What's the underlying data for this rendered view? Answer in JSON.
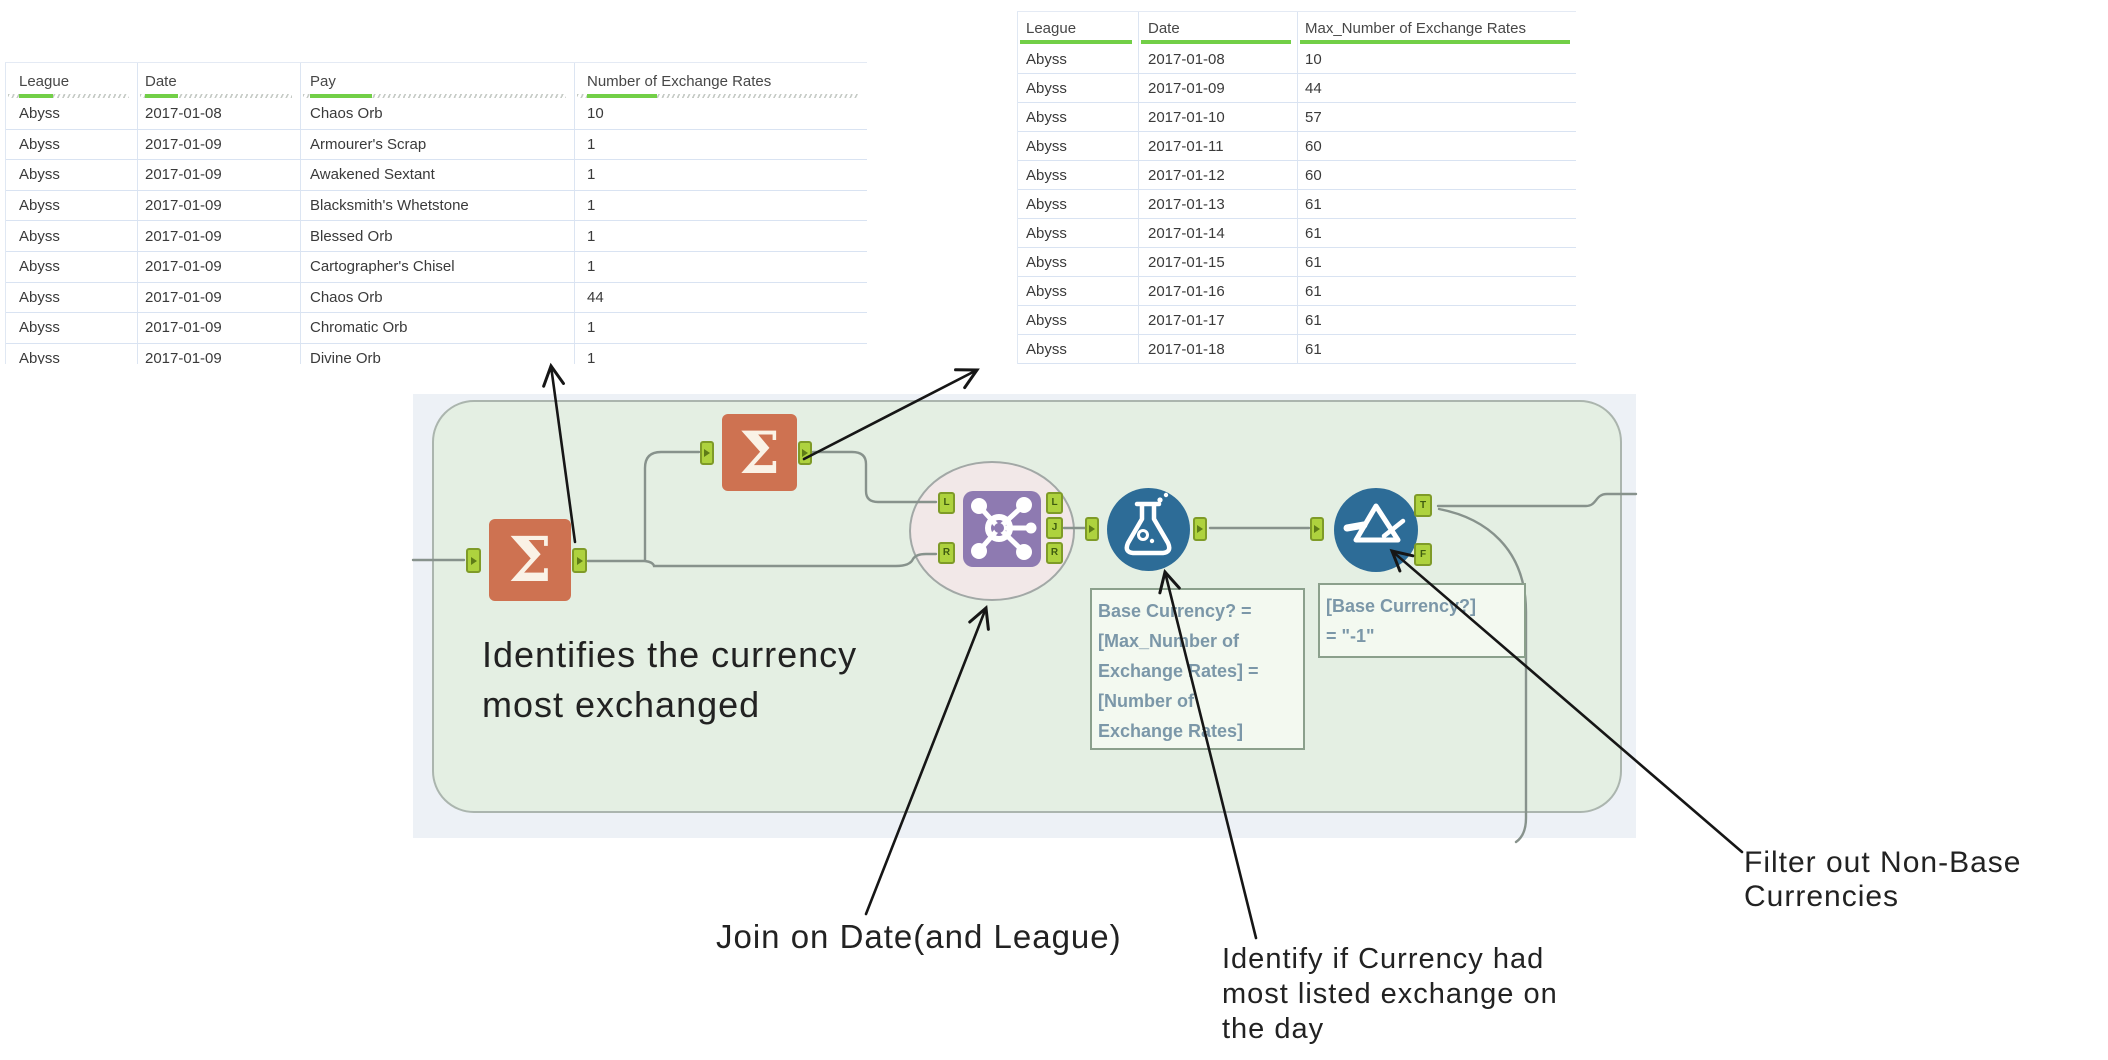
{
  "left_table": {
    "columns": [
      "League",
      "Date",
      "Pay",
      "Number of Exchange Rates"
    ],
    "rows": [
      [
        "Abyss",
        "2017-01-08",
        "Chaos Orb",
        "10"
      ],
      [
        "Abyss",
        "2017-01-09",
        "Armourer's Scrap",
        "1"
      ],
      [
        "Abyss",
        "2017-01-09",
        "Awakened Sextant",
        "1"
      ],
      [
        "Abyss",
        "2017-01-09",
        "Blacksmith's Whetstone",
        "1"
      ],
      [
        "Abyss",
        "2017-01-09",
        "Blessed Orb",
        "1"
      ],
      [
        "Abyss",
        "2017-01-09",
        "Cartographer's Chisel",
        "1"
      ],
      [
        "Abyss",
        "2017-01-09",
        "Chaos Orb",
        "44"
      ],
      [
        "Abyss",
        "2017-01-09",
        "Chromatic Orb",
        "1"
      ]
    ],
    "clipped_row": [
      "Abyss",
      "2017-01-09",
      "Divine Orb",
      "1"
    ]
  },
  "right_table": {
    "columns": [
      "League",
      "Date",
      "Max_Number of Exchange Rates"
    ],
    "rows": [
      [
        "Abyss",
        "2017-01-08",
        "10"
      ],
      [
        "Abyss",
        "2017-01-09",
        "44"
      ],
      [
        "Abyss",
        "2017-01-10",
        "57"
      ],
      [
        "Abyss",
        "2017-01-11",
        "60"
      ],
      [
        "Abyss",
        "2017-01-12",
        "60"
      ],
      [
        "Abyss",
        "2017-01-13",
        "61"
      ],
      [
        "Abyss",
        "2017-01-14",
        "61"
      ],
      [
        "Abyss",
        "2017-01-15",
        "61"
      ],
      [
        "Abyss",
        "2017-01-16",
        "61"
      ],
      [
        "Abyss",
        "2017-01-17",
        "61"
      ],
      [
        "Abyss",
        "2017-01-18",
        "61"
      ]
    ]
  },
  "workflow": {
    "container_note": "Identifies the currency\nmost exchanged",
    "formula_annotation": "Base Currency? =\n[Max_Number of\nExchange Rates] =\n[Number of\nExchange Rates]",
    "filter_annotation": "[Base Currency?]\n= \"-1\"",
    "anchors": {
      "join_inputs": [
        "L",
        "R"
      ],
      "join_outputs": [
        "L",
        "J",
        "R"
      ],
      "filter_outputs": [
        "T",
        "F"
      ]
    }
  },
  "icons": {
    "summarize": "Σ"
  },
  "callouts": {
    "join": "Join on Date(and League)",
    "formula": "Identify if Currency had\nmost listed exchange on\nthe day",
    "filter": "Filter out Non-Base\nCurrencies"
  },
  "colors": {
    "tool_orange": "#ce7251",
    "tool_purple": "#8e7ab1",
    "tool_blue": "#2d6c97",
    "anchor_green": "#aed23e",
    "anchor_border": "#7f9b28",
    "container_green": "#e4efe3",
    "container_border": "#abb5ae",
    "canvas_bg": "#edf1f6",
    "wire": "#87928c",
    "header_green": "#72cf47",
    "ellipse_pink": "#f2e8e8",
    "note_bg": "#f3f9f0",
    "note_border": "#8ba08c",
    "note_text": "#7b97a8"
  }
}
